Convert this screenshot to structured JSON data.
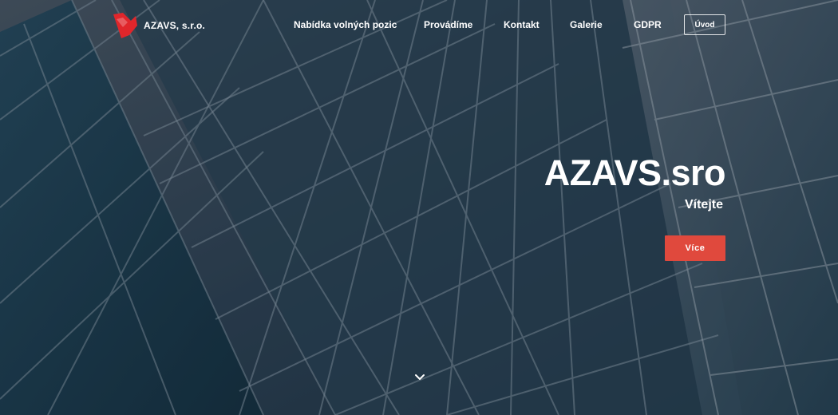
{
  "brand": {
    "name": "AZAVS, s.r.o.",
    "logo_text": "AZAVS",
    "logo_color": "#e0262b"
  },
  "nav": {
    "items": [
      {
        "label": "Nabídka volných pozic"
      },
      {
        "label": "Provádíme"
      },
      {
        "label": "Kontakt"
      },
      {
        "label": "Galerie"
      },
      {
        "label": "GDPR"
      }
    ],
    "button_label": "Úvod"
  },
  "hero": {
    "title": "AZAVS.sro",
    "subtitle": "Vítejte",
    "cta_label": "Více",
    "cta_color": "#e0493d",
    "scroll_icon": "chevron-down-icon"
  }
}
